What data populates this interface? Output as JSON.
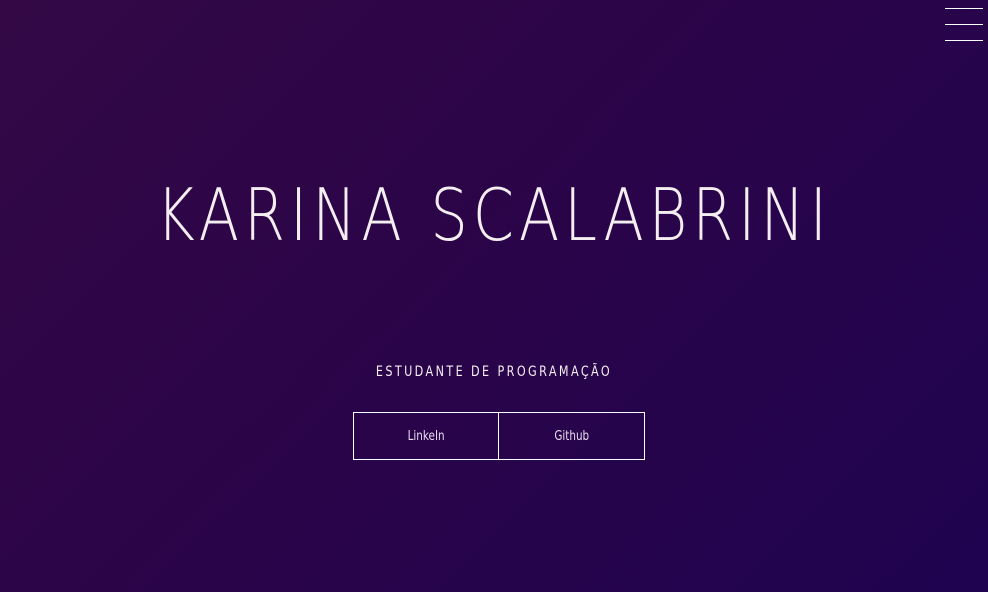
{
  "header": {
    "menu_icon": "hamburger-menu-icon"
  },
  "hero": {
    "title": "KARINA SCALABRINI",
    "subtitle": "ESTUDANTE DE PROGRAMAÇÃO"
  },
  "links": [
    {
      "label": "LinkeIn"
    },
    {
      "label": "Github"
    }
  ],
  "colors": {
    "background_start": "#330845",
    "background_end": "#1f0350",
    "text": "#f4eef0",
    "button_border": "#ffffff"
  }
}
